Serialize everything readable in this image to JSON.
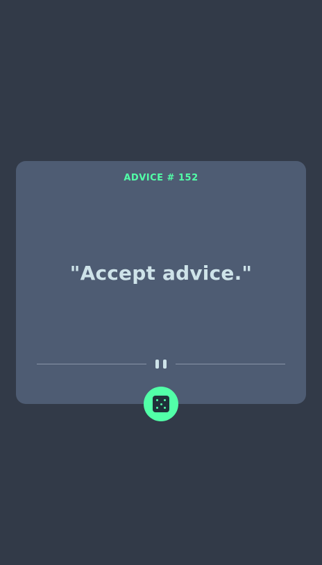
{
  "advice": {
    "id_label": "ADVICE # 152",
    "quote": "\"Accept advice.\""
  },
  "icons": {
    "divider": "pause-icon",
    "button": "dice-icon"
  },
  "colors": {
    "background": "#323a48",
    "card": "#4e5c73",
    "accent": "#52ffa8",
    "text": "#cee3e9"
  }
}
